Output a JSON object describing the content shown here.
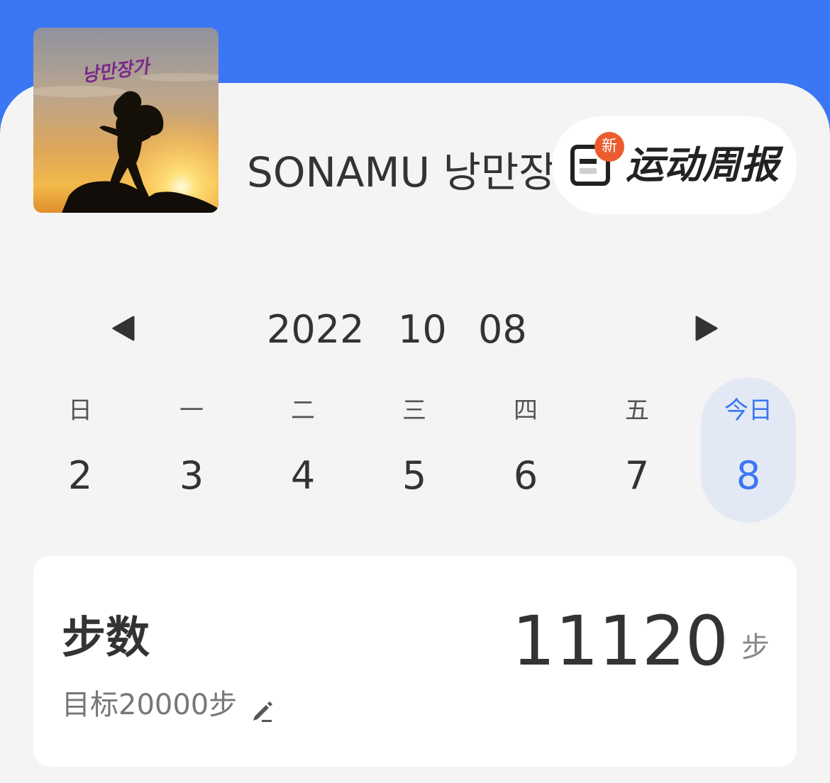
{
  "user": {
    "name": "SONAMU 낭만장가",
    "avatar_caption": "낭만장가"
  },
  "weekly_report": {
    "label": "运动周报",
    "badge": "新",
    "icon": "report-icon"
  },
  "date_nav": {
    "year": "2022",
    "month": "10",
    "day": "08",
    "prev_icon": "chevron-left-icon",
    "next_icon": "chevron-right-icon"
  },
  "week": [
    {
      "weekday": "日",
      "day": "2"
    },
    {
      "weekday": "一",
      "day": "3"
    },
    {
      "weekday": "二",
      "day": "4"
    },
    {
      "weekday": "三",
      "day": "5"
    },
    {
      "weekday": "四",
      "day": "6"
    },
    {
      "weekday": "五",
      "day": "7"
    },
    {
      "weekday": "今日",
      "day": "8"
    }
  ],
  "steps": {
    "title": "步数",
    "value": "11120",
    "unit": "步",
    "goal": "目标20000步",
    "edit_icon": "pencil-icon"
  },
  "colors": {
    "header_blue": "#3b76f5",
    "badge_red": "#ec5c2f",
    "today_highlight": "#e3e9f4"
  }
}
